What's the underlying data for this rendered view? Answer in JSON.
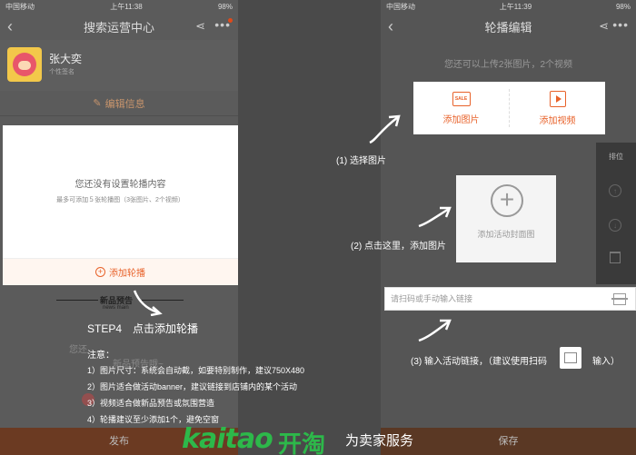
{
  "left_phone": {
    "status": {
      "carrier": "中国移动",
      "time": "上午11:38",
      "battery": "98%"
    },
    "title": "搜索运营中心",
    "profile": {
      "name": "张大奕",
      "signature": "个性签名"
    },
    "edit_label": "编辑信息",
    "carousel": {
      "empty_text": "您还没有设置轮播内容",
      "hint": "最多可添加５张轮播图（3张图片、2个视频）",
      "add_label": "添加轮播"
    },
    "section": {
      "title": "新品预告",
      "subtitle": "news main"
    },
    "behind_text": "您还",
    "behind_text2": "新品预告哦~",
    "publish_label": "发布"
  },
  "instructions": {
    "step4": "STEP4　点击添加轮播",
    "notes_title": "注意：",
    "notes": [
      "1）图片尺寸：系统会自动截，如要特别制作，建议750X480",
      "2）图片适合做活动banner，建议链接到店铺内的某个活动",
      "3）视频适合做新品预告或氛围营造",
      "4）轮播建议至少添加1个，避免空窗"
    ]
  },
  "right_phone": {
    "status": {
      "carrier": "中国移动",
      "time": "上午11:39",
      "battery": "98%"
    },
    "title": "轮播编辑",
    "upload_hint": "您还可以上传2张图片，2个视频",
    "add_image": "添加图片",
    "add_video": "添加视频",
    "sort_label": "排位",
    "cover_label": "添加活动封面图",
    "link_placeholder": "请扫码或手动输入链接",
    "save_label": "保存"
  },
  "annotations": {
    "a1": "(1) 选择图片",
    "a2": "(2) 点击这里，添加图片",
    "a3_pre": "(3) 输入活动链接，（建议使用扫码",
    "a3_post": "输入）"
  },
  "branding": {
    "logo": "kaitao",
    "logo_cn": "开淘",
    "tagline": "为卖家服务"
  },
  "colors": {
    "accent": "#e8622a",
    "brand_green": "#2db84a"
  }
}
